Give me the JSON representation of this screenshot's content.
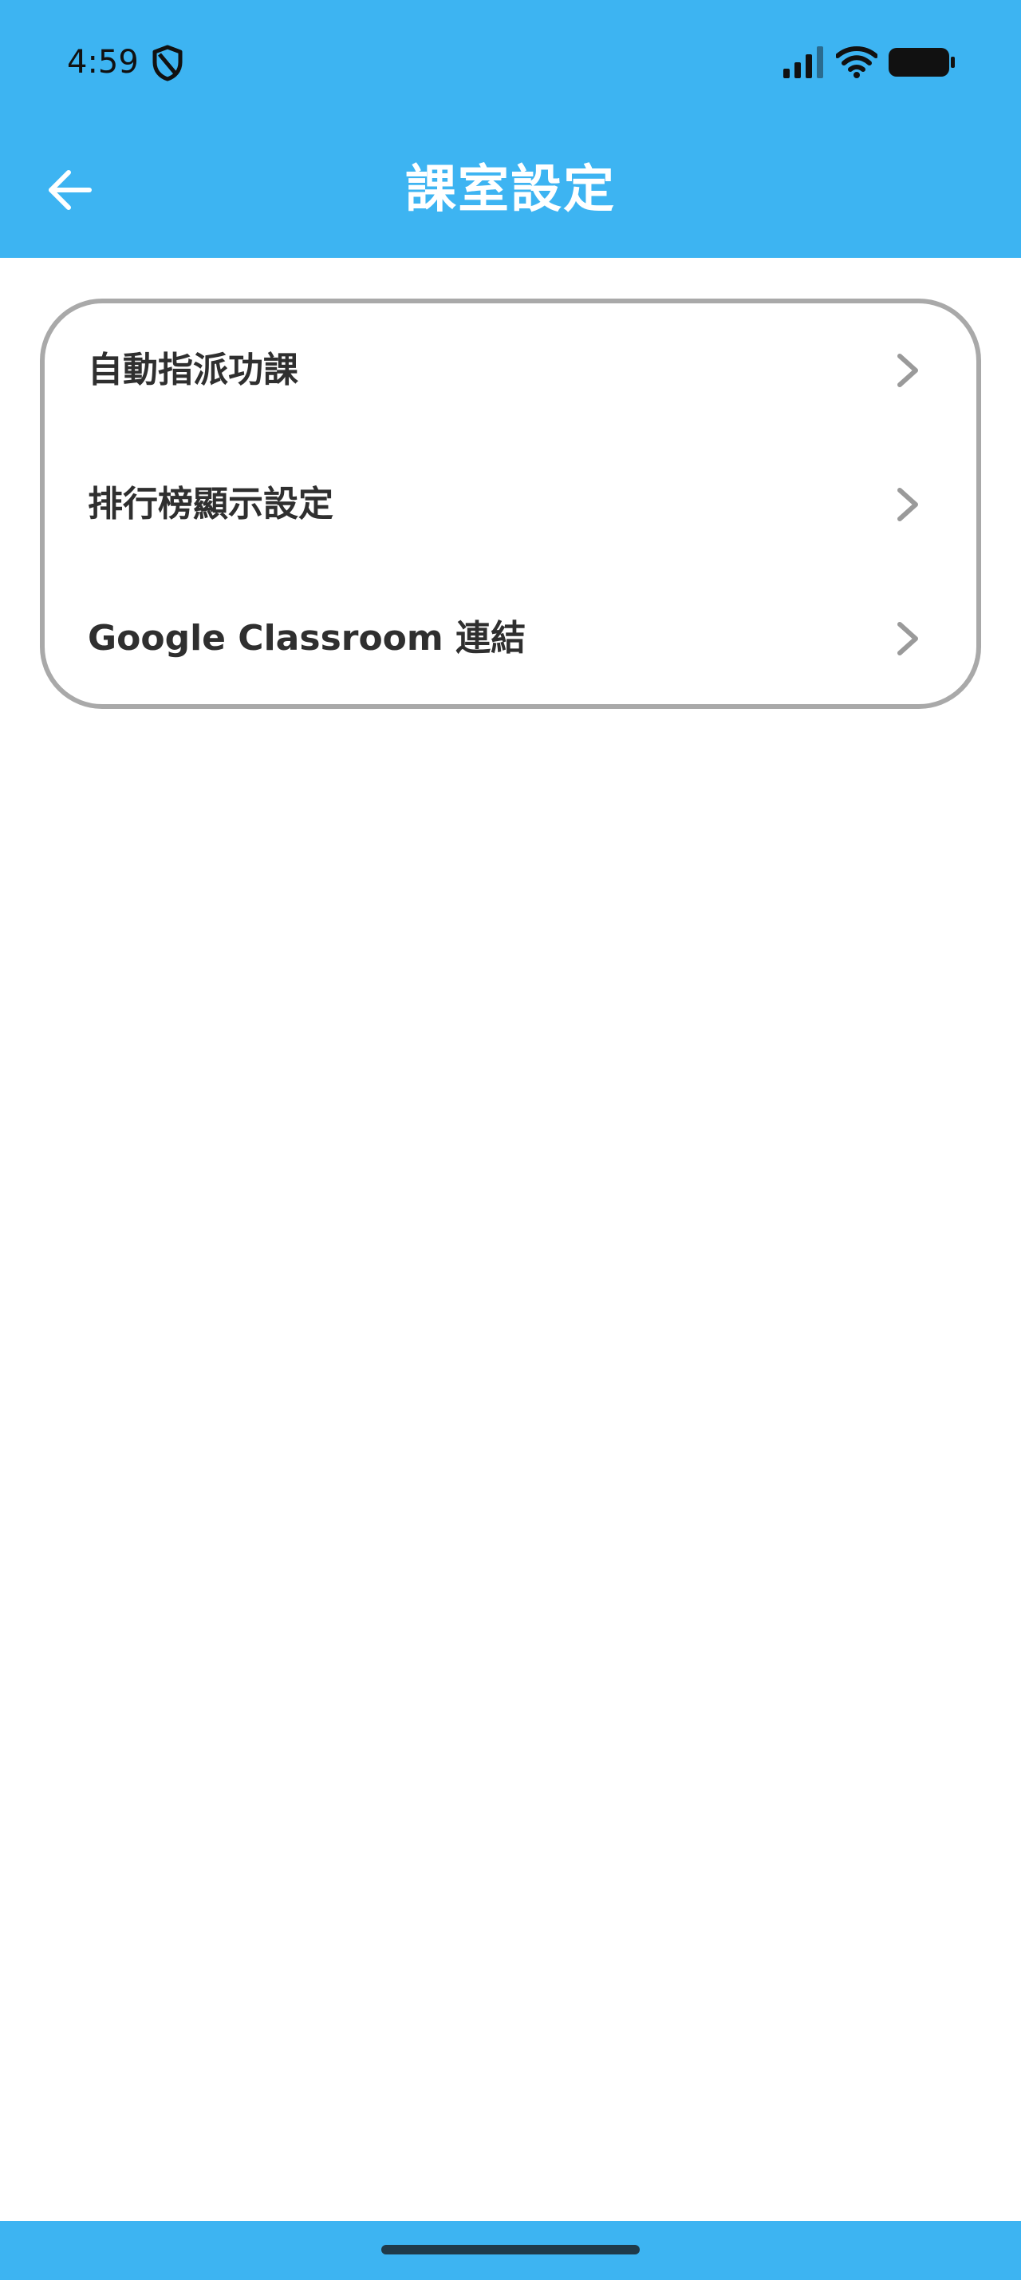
{
  "status_bar": {
    "time": "4:59",
    "icons": [
      "shield-icon",
      "signal-icon",
      "wifi-icon",
      "battery-icon"
    ]
  },
  "header": {
    "title": "課室設定",
    "back_icon": "arrow-left-icon"
  },
  "settings": {
    "items": [
      {
        "label": "自動指派功課",
        "icon": "chevron-right-icon"
      },
      {
        "label": "排行榜顯示設定",
        "icon": "chevron-right-icon"
      },
      {
        "label": "Google Classroom 連結",
        "icon": "chevron-right-icon"
      }
    ]
  },
  "colors": {
    "primary": "#3db4f2",
    "card_border": "#a9a9a9",
    "text": "#2f2f2f",
    "chevron": "#9a9a9a"
  }
}
